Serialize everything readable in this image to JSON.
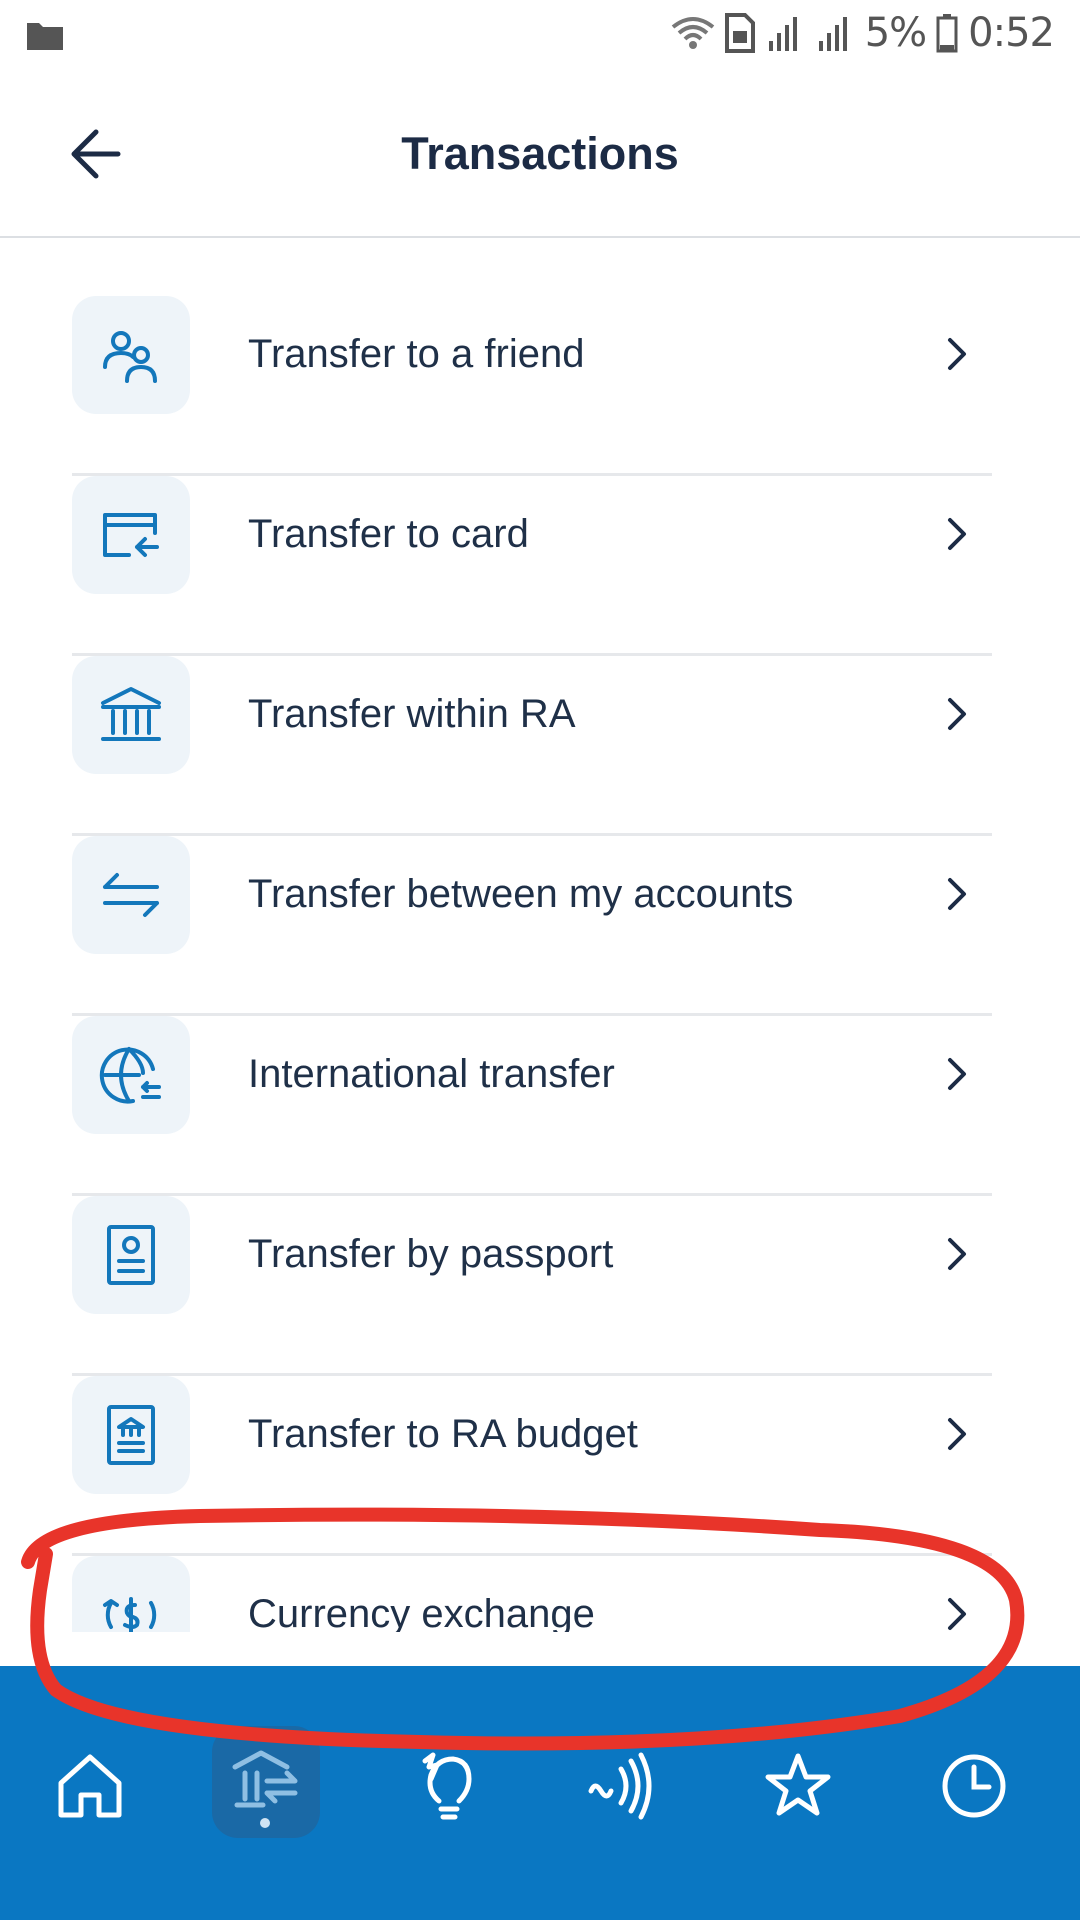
{
  "status_bar": {
    "battery": "5%",
    "time": "0:52",
    "icons": [
      "folder-icon",
      "wifi-icon",
      "sim-icon",
      "signal-icon",
      "signal-icon",
      "battery-icon"
    ]
  },
  "header": {
    "title": "Transactions",
    "back_icon": "arrow-left-icon"
  },
  "menu": {
    "items": [
      {
        "label": "Transfer to a friend",
        "icon": "friends-icon"
      },
      {
        "label": "Transfer to card",
        "icon": "card-transfer-icon"
      },
      {
        "label": "Transfer within RA",
        "icon": "bank-icon"
      },
      {
        "label": "Transfer between my accounts",
        "icon": "swap-arrows-icon"
      },
      {
        "label": "International transfer",
        "icon": "globe-transfer-icon"
      },
      {
        "label": "Transfer by passport",
        "icon": "passport-icon"
      },
      {
        "label": "Transfer to RA budget",
        "icon": "budget-icon"
      },
      {
        "label": "Currency exchange",
        "icon": "currency-exchange-icon"
      }
    ]
  },
  "bottom_nav": {
    "items": [
      {
        "icon": "home-icon",
        "active": false
      },
      {
        "icon": "transfers-icon",
        "active": true
      },
      {
        "icon": "payments-icon",
        "active": false
      },
      {
        "icon": "contactless-icon",
        "active": false
      },
      {
        "icon": "star-icon",
        "active": false
      },
      {
        "icon": "history-icon",
        "active": false
      }
    ]
  },
  "colors": {
    "primary": "#0a77c2",
    "title": "#1c2b45",
    "icon_blue": "#1377bb",
    "tile_bg": "#eef4f9",
    "annotation": "#e8342a"
  }
}
